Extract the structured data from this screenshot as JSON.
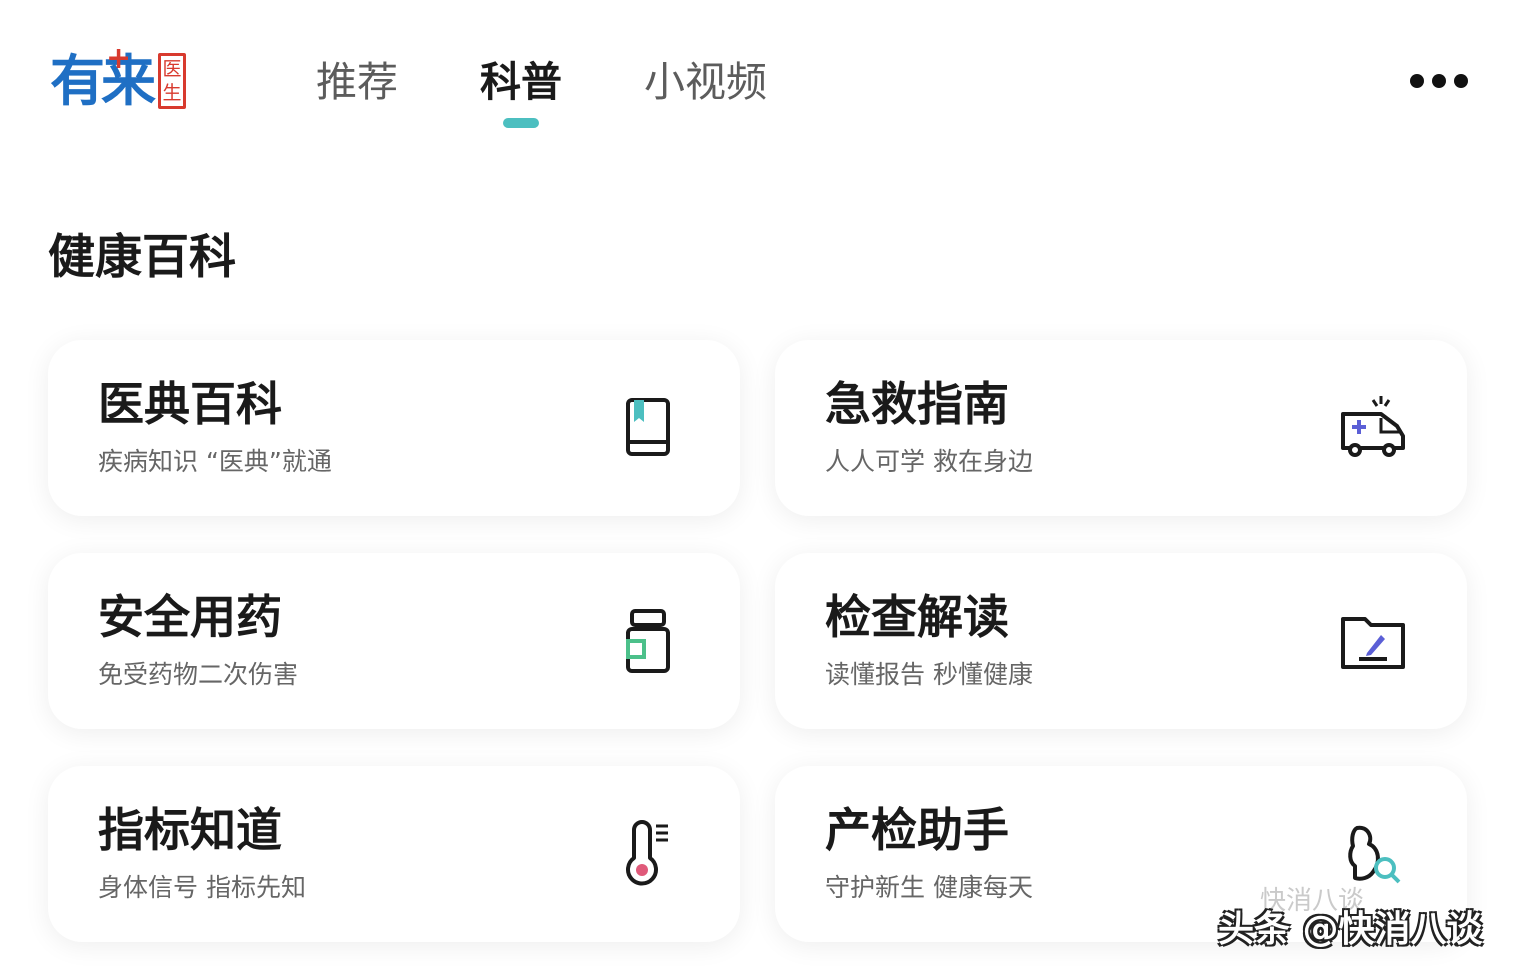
{
  "header": {
    "logo_text": "有来",
    "logo_cross": "+",
    "logo_badge_1": "医",
    "logo_badge_2": "生",
    "tabs": [
      {
        "label": "推荐",
        "active": false
      },
      {
        "label": "科普",
        "active": true
      },
      {
        "label": "小视频",
        "active": false
      }
    ],
    "more_icon": "more-dots-icon"
  },
  "section": {
    "title": "健康百科"
  },
  "cards": [
    {
      "title": "医典百科",
      "subtitle": "疾病知识 “医典”就通",
      "icon": "book-icon"
    },
    {
      "title": "急救指南",
      "subtitle": "人人可学 救在身边",
      "icon": "ambulance-icon"
    },
    {
      "title": "安全用药",
      "subtitle": "免受药物二次伤害",
      "icon": "medicine-bottle-icon"
    },
    {
      "title": "检查解读",
      "subtitle": "读懂报告 秒懂健康",
      "icon": "folder-edit-icon"
    },
    {
      "title": "指标知道",
      "subtitle": "身体信号 指标先知",
      "icon": "thermometer-icon"
    },
    {
      "title": "产检助手",
      "subtitle": "守护新生 健康每天",
      "icon": "pregnancy-search-icon"
    }
  ],
  "watermark": {
    "text": "头条 @快消八谈",
    "faint_text": "快消八谈"
  },
  "colors": {
    "accent": "#4cbfc0",
    "logo_blue": "#1f6fc4",
    "logo_red": "#d83a2e",
    "icon_purple": "#5b5fd6",
    "icon_green": "#4cc08a",
    "icon_pink": "#e05a7a"
  }
}
